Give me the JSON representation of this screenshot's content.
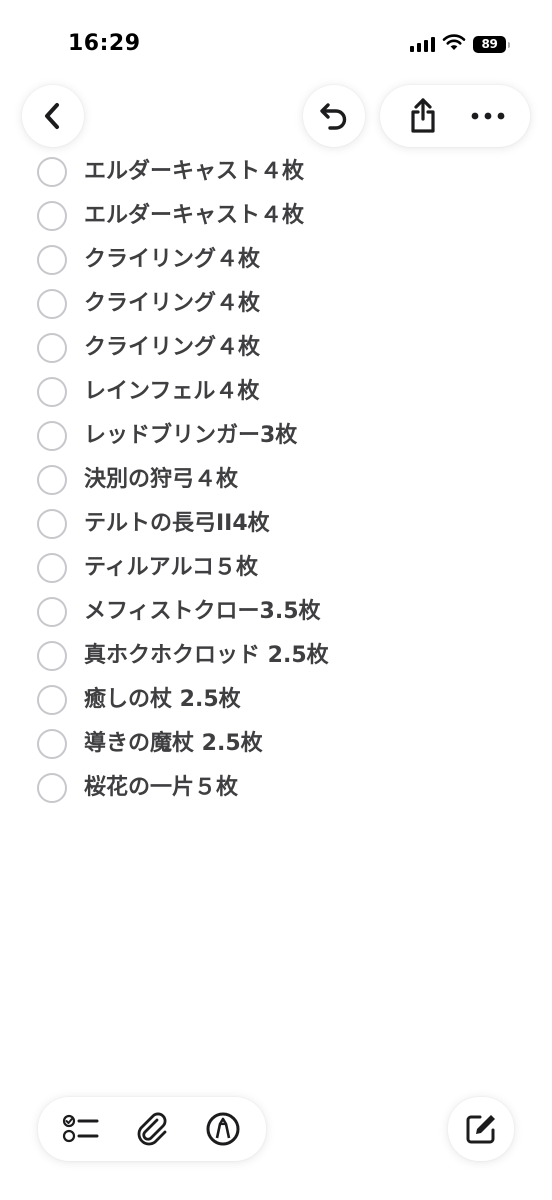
{
  "status_bar": {
    "time": "16:29",
    "battery": "89"
  },
  "icons": {
    "back": "chevron-left-icon",
    "undo": "undo-icon",
    "share": "share-icon",
    "more": "more-horizontal-icon",
    "checklist": "checklist-icon",
    "attachment": "paperclip-icon",
    "markup": "pen-markup-icon",
    "compose": "compose-icon"
  },
  "checklist": {
    "items": [
      {
        "label": "エルダーキャスト４枚",
        "checked": false
      },
      {
        "label": "エルダーキャスト４枚",
        "checked": false
      },
      {
        "label": "クライリング４枚",
        "checked": false
      },
      {
        "label": "クライリング４枚",
        "checked": false
      },
      {
        "label": "クライリング４枚",
        "checked": false
      },
      {
        "label": "レインフェル４枚",
        "checked": false
      },
      {
        "label": "レッドブリンガー3枚",
        "checked": false
      },
      {
        "label": "決別の狩弓４枚",
        "checked": false
      },
      {
        "label": "テルトの長弓II4枚",
        "checked": false
      },
      {
        "label": "ティルアルコ５枚",
        "checked": false
      },
      {
        "label": "メフィストクロー3.5枚",
        "checked": false
      },
      {
        "label": "真ホクホクロッド 2.5枚",
        "checked": false
      },
      {
        "label": "癒しの杖 2.5枚",
        "checked": false
      },
      {
        "label": "導きの魔杖 2.5枚",
        "checked": false
      },
      {
        "label": "桜花の一片５枚",
        "checked": false
      }
    ]
  }
}
